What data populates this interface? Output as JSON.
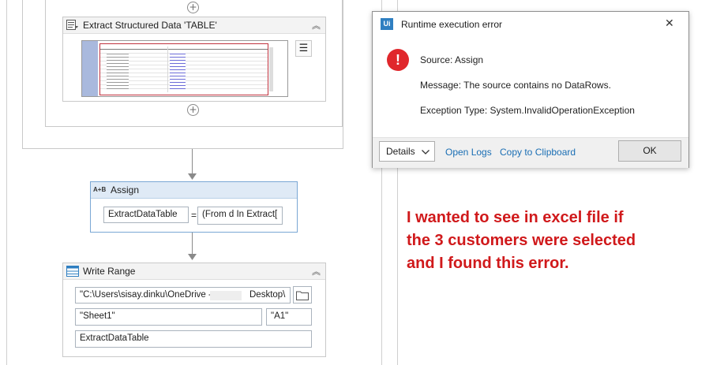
{
  "extract_activity": {
    "title": "Extract Structured Data 'TABLE'"
  },
  "assign_activity": {
    "icon_text": "A+B",
    "title": "Assign",
    "to_value": "ExtractDataTable",
    "equals": "=",
    "value_expression": "(From d In Extract["
  },
  "write_range_activity": {
    "title": "Write Range",
    "path_value": "\"C:\\Users\\sisay.dinku\\OneDrive -",
    "path_suffix": "Desktop\\",
    "sheet_value": "\"Sheet1\"",
    "cell_value": "\"A1\"",
    "datatable_value": "ExtractDataTable"
  },
  "dialog": {
    "title": "Runtime execution error",
    "logo_text": "Ui",
    "close_glyph": "✕",
    "source": "Source: Assign",
    "message": "Message: The source contains no DataRows.",
    "exception": "Exception Type: System.InvalidOperationException",
    "details_label": "Details",
    "open_logs_label": "Open Logs",
    "copy_label": "Copy to Clipboard",
    "ok_label": "OK",
    "error_color": "#e0272c",
    "link_color": "#1a6eb4"
  },
  "annotation": {
    "text": "I wanted to see in excel file if the 3 customers were selected and I found this error.",
    "color": "#d0191b"
  }
}
